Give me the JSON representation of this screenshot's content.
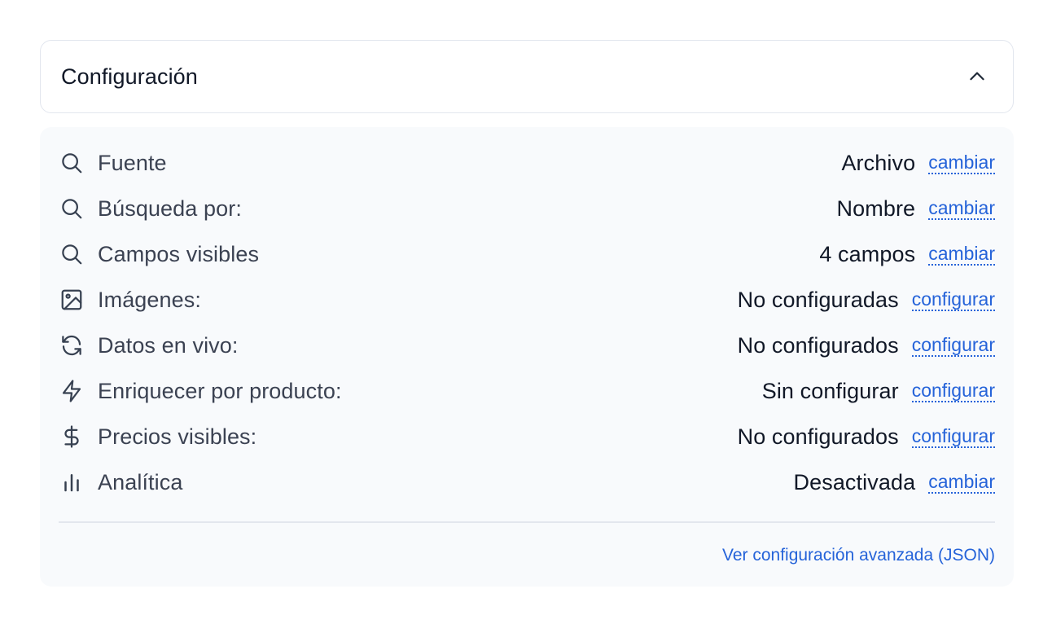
{
  "header": {
    "title": "Configuración",
    "toggle_icon": "chevron-up-icon"
  },
  "settings": [
    {
      "icon": "search-icon",
      "label": "Fuente",
      "value": "Archivo",
      "action": "cambiar"
    },
    {
      "icon": "search-icon",
      "label": "Búsqueda por:",
      "value": "Nombre",
      "action": "cambiar"
    },
    {
      "icon": "search-icon",
      "label": "Campos visibles",
      "value": "4 campos",
      "action": "cambiar"
    },
    {
      "icon": "image-icon",
      "label": "Imágenes:",
      "value": "No configuradas",
      "action": "configurar"
    },
    {
      "icon": "refresh-icon",
      "label": "Datos en vivo:",
      "value": "No configurados",
      "action": "configurar"
    },
    {
      "icon": "bolt-icon",
      "label": "Enriquecer por producto:",
      "value": "Sin configurar",
      "action": "configurar"
    },
    {
      "icon": "dollar-icon",
      "label": "Precios visibles:",
      "value": "No configurados",
      "action": "configurar"
    },
    {
      "icon": "bar-chart-icon",
      "label": "Analítica",
      "value": "Desactivada",
      "action": "cambiar"
    }
  ],
  "footer": {
    "advanced_link": "Ver configuración avanzada (JSON)"
  },
  "colors": {
    "accent": "#2563d9",
    "panel_bg": "#f8fafc",
    "border": "#e2e6ee"
  }
}
